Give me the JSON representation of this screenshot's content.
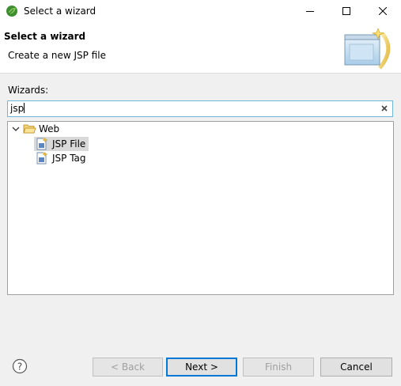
{
  "window": {
    "title": "Select a wizard"
  },
  "header": {
    "title": "Select a wizard",
    "description": "Create a new JSP file"
  },
  "filter": {
    "label": "Wizards:",
    "value": "jsp"
  },
  "tree": {
    "category": "Web",
    "items": [
      {
        "label": "JSP File",
        "selected": true
      },
      {
        "label": "JSP Tag",
        "selected": false
      }
    ]
  },
  "buttons": {
    "back": "< Back",
    "next": "Next >",
    "finish": "Finish",
    "cancel": "Cancel"
  },
  "icons": {
    "app": "eclipse-leaf-icon",
    "help": "question-mark-icon",
    "clear": "close-x-icon",
    "folder": "folder-open-icon",
    "file": "jsp-file-icon"
  }
}
